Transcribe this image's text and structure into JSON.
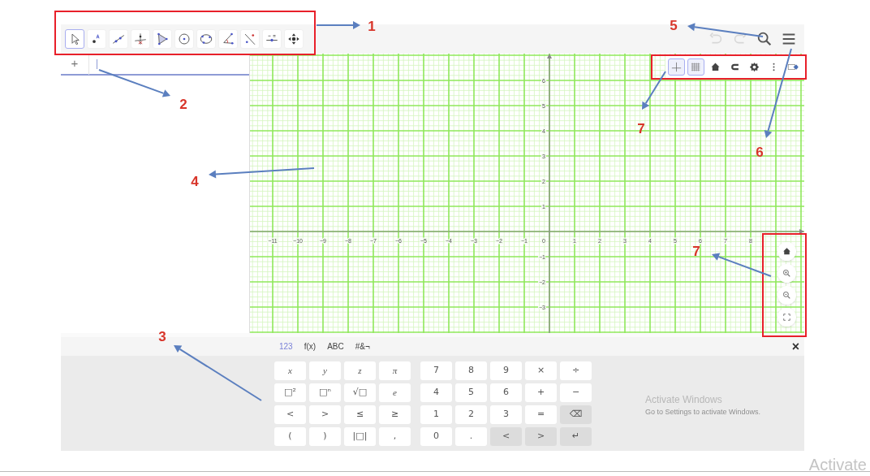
{
  "toolbar": {
    "tools": [
      {
        "kind": "move",
        "selected": true
      },
      {
        "kind": "point",
        "selected": false
      },
      {
        "kind": "line",
        "selected": false
      },
      {
        "kind": "perpendicular",
        "selected": false
      },
      {
        "kind": "polygon",
        "selected": false
      },
      {
        "kind": "circle",
        "selected": false
      },
      {
        "kind": "conic",
        "selected": false
      },
      {
        "kind": "angle",
        "selected": false
      },
      {
        "kind": "reflect",
        "selected": false
      },
      {
        "kind": "slider",
        "selected": false
      },
      {
        "kind": "pan",
        "selected": false
      }
    ]
  },
  "header_actions": [
    {
      "kind": "undo",
      "disabled": true
    },
    {
      "kind": "redo",
      "disabled": true
    },
    {
      "kind": "search",
      "disabled": false
    },
    {
      "kind": "menu",
      "disabled": false
    }
  ],
  "algebra": {
    "add_button": "+"
  },
  "graphics": {
    "style_bar": [
      {
        "kind": "axes",
        "selected": true
      },
      {
        "kind": "grid",
        "selected": true
      },
      {
        "kind": "home",
        "selected": false
      },
      {
        "kind": "magnet",
        "selected": false
      },
      {
        "kind": "settings",
        "selected": false
      },
      {
        "kind": "more",
        "selected": false
      },
      {
        "kind": "toggle",
        "selected": false
      }
    ],
    "x_labels": [
      "−11",
      "−10",
      "−9",
      "−8",
      "−7",
      "−6",
      "−5",
      "−4",
      "−3",
      "−2",
      "−1",
      "0",
      "1",
      "2",
      "3",
      "4",
      "5",
      "6",
      "7",
      "8"
    ],
    "y_labels": [
      "6",
      "5",
      "4",
      "3",
      "2",
      "1",
      "−1",
      "−2",
      "−3"
    ],
    "zoom_buttons": [
      {
        "kind": "home"
      },
      {
        "kind": "zoom-in"
      },
      {
        "kind": "zoom-out"
      },
      {
        "kind": "fullscreen"
      }
    ]
  },
  "keyboard": {
    "tabs": [
      {
        "label": "123",
        "selected": true
      },
      {
        "label": "f(x)",
        "selected": false
      },
      {
        "label": "ABC",
        "selected": false
      },
      {
        "label": "#&¬",
        "selected": false
      }
    ],
    "close": "×",
    "blocks": [
      {
        "rows": [
          [
            {
              "label": "x",
              "kind": "var"
            },
            {
              "label": "y",
              "kind": "var"
            },
            {
              "label": "z",
              "kind": "var"
            },
            {
              "label": "π",
              "kind": "var"
            }
          ],
          [
            {
              "label": "□²",
              "kind": "key"
            },
            {
              "label": "□ⁿ",
              "kind": "key"
            },
            {
              "label": "√□",
              "kind": "key"
            },
            {
              "label": "e",
              "kind": "var"
            }
          ],
          [
            {
              "label": "<",
              "kind": "key"
            },
            {
              "label": ">",
              "kind": "key"
            },
            {
              "label": "≤",
              "kind": "key"
            },
            {
              "label": "≥",
              "kind": "key"
            }
          ],
          [
            {
              "label": "(",
              "kind": "key"
            },
            {
              "label": ")",
              "kind": "key"
            },
            {
              "label": "|□|",
              "kind": "key"
            },
            {
              "label": ",",
              "kind": "key"
            }
          ]
        ]
      },
      {
        "rows": [
          [
            {
              "label": "7",
              "kind": "key"
            },
            {
              "label": "8",
              "kind": "key"
            },
            {
              "label": "9",
              "kind": "key"
            },
            {
              "label": "×",
              "kind": "key"
            },
            {
              "label": "÷",
              "kind": "key"
            }
          ],
          [
            {
              "label": "4",
              "kind": "key"
            },
            {
              "label": "5",
              "kind": "key"
            },
            {
              "label": "6",
              "kind": "key"
            },
            {
              "label": "+",
              "kind": "key"
            },
            {
              "label": "−",
              "kind": "key"
            }
          ],
          [
            {
              "label": "1",
              "kind": "key"
            },
            {
              "label": "2",
              "kind": "key"
            },
            {
              "label": "3",
              "kind": "key"
            },
            {
              "label": "=",
              "kind": "key"
            },
            {
              "label": "⌫",
              "kind": "action"
            }
          ],
          [
            {
              "label": "0",
              "kind": "key"
            },
            {
              "label": ".",
              "kind": "key"
            },
            {
              "label": "<",
              "kind": "action"
            },
            {
              "label": ">",
              "kind": "action"
            },
            {
              "label": "↵",
              "kind": "action"
            }
          ]
        ]
      }
    ]
  },
  "activation_notice": {
    "title": "Activate Windows",
    "subtitle": "Go to Settings to activate Windows."
  },
  "edge_text": "Activate",
  "callouts": [
    {
      "label": "1"
    },
    {
      "label": "2"
    },
    {
      "label": "3"
    },
    {
      "label": "4"
    },
    {
      "label": "5"
    },
    {
      "label": "6"
    },
    {
      "label": "7"
    },
    {
      "label": "7"
    }
  ]
}
